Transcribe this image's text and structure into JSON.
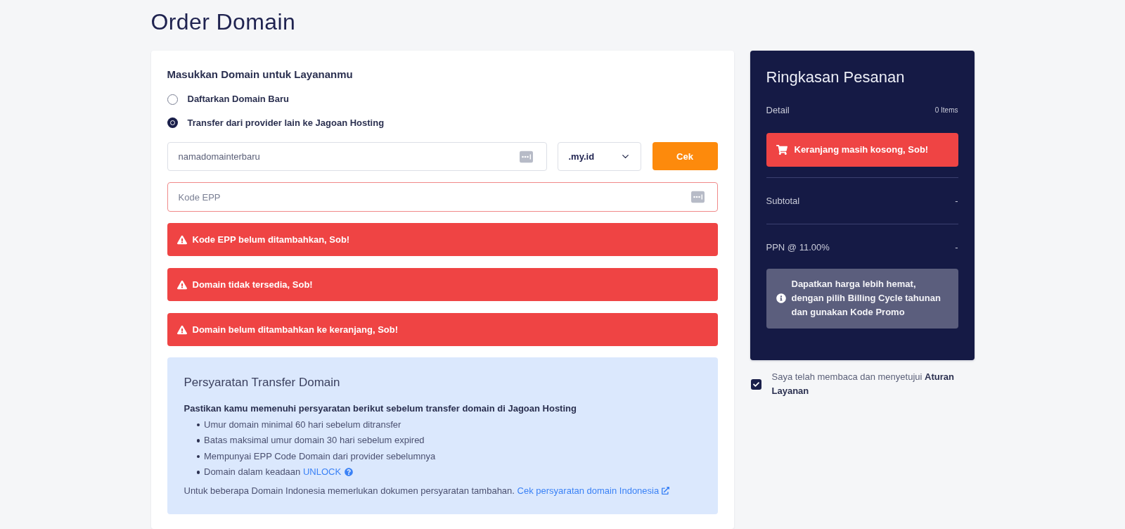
{
  "page": {
    "title": "Order Domain"
  },
  "domain_form": {
    "heading": "Masukkan Domain untuk Layananmu",
    "options": [
      {
        "label": "Daftarkan Domain Baru",
        "selected": false
      },
      {
        "label": "Transfer dari provider lain ke Jagoan Hosting",
        "selected": true
      }
    ],
    "domain_field": {
      "placeholder": "namadomainterbaru"
    },
    "extension_select": {
      "value": ".my.id"
    },
    "check_button": {
      "label": "Cek"
    },
    "epp_field": {
      "placeholder": "Kode EPP",
      "error": true
    },
    "alerts": [
      {
        "text": "Kode EPP belum ditambahkan, Sob!"
      },
      {
        "text": "Domain tidak tersedia, Sob!"
      },
      {
        "text": "Domain belum ditambahkan ke keranjang, Sob!"
      }
    ]
  },
  "requirements": {
    "title": "Persyaratan Transfer Domain",
    "intro": "Pastikan kamu memenuhi persyaratan berikut sebelum transfer domain di Jagoan Hosting",
    "items": [
      {
        "text": "Umur domain minimal 60 hari sebelum ditransfer"
      },
      {
        "text": "Batas maksimal umur domain 30 hari sebelum expired"
      },
      {
        "text": "Mempunyai EPP Code Domain dari provider sebelumnya"
      },
      {
        "text": "Domain dalam keadaan",
        "link": "UNLOCK"
      }
    ],
    "note": {
      "text": "Untuk beberapa Domain Indonesia memerlukan dokumen persyaratan tambahan.",
      "link": "Cek persyaratan domain Indonesia"
    }
  },
  "summary": {
    "title": "Ringkasan Pesanan",
    "detail_label": "Detail",
    "item_count": "0 Items",
    "cart_alert": "Keranjang masih kosong, Sob!",
    "rows": [
      {
        "label": "Subtotal",
        "value": "-"
      },
      {
        "label": "PPN @ 11.00%",
        "value": "-"
      }
    ],
    "tip": "Dapatkan harga lebih hemat, dengan pilih Billing Cycle tahunan dan gunakan Kode Promo"
  },
  "terms": {
    "text": "Saya telah membaca dan menyetujui **Aturan Layanan**",
    "checked": true
  }
}
